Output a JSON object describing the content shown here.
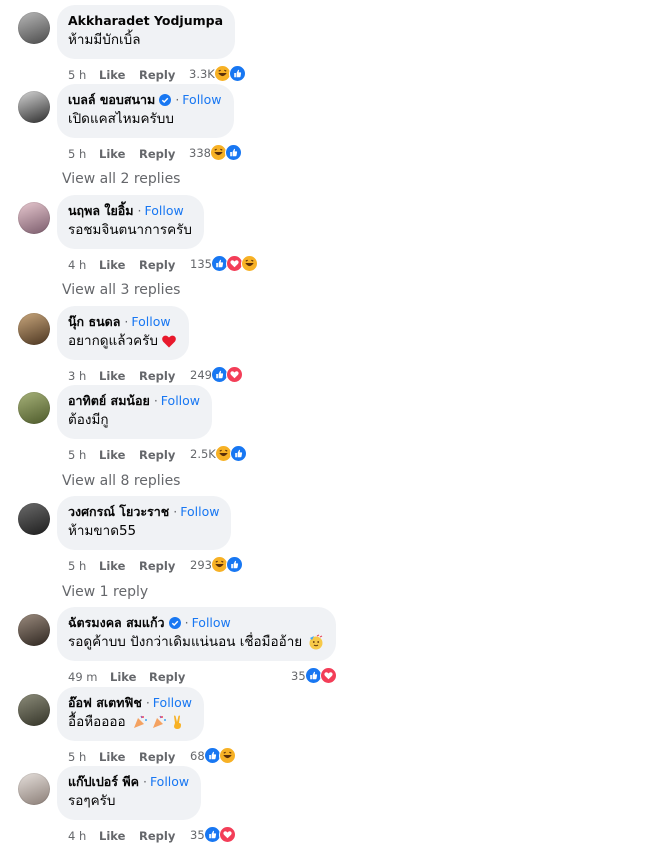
{
  "follow_label": "Follow",
  "like_label": "Like",
  "reply_label": "Reply",
  "comments": [
    {
      "name": "Akkharadet Yodjumpa",
      "text": "ห้ามมีบักเบิ้ล",
      "time": "5 h",
      "count": "3.3K",
      "reactions": [
        "haha",
        "like"
      ],
      "follow": false,
      "verified": false
    },
    {
      "name": "เบลล์ ขอบสนาม",
      "text": "เปิดแคสไหมครับบ",
      "time": "5 h",
      "count": "338",
      "reactions": [
        "haha",
        "like"
      ],
      "follow": true,
      "verified": true
    },
    {
      "name": "นฤพล ใยอิ้ม",
      "text": "รอชมจินตนาการครับ",
      "time": "4 h",
      "count": "135",
      "reactions": [
        "like",
        "love",
        "haha"
      ],
      "follow": true,
      "verified": false
    },
    {
      "name": "นุ๊ก ธนดล",
      "text": "อยากดูแล้วครับ",
      "time": "3 h",
      "count": "249",
      "reactions": [
        "like",
        "love"
      ],
      "follow": true,
      "verified": false,
      "trailing": "heart"
    },
    {
      "name": "อาทิตย์ สมน้อย",
      "text": "ต้องมีกู",
      "time": "5 h",
      "count": "2.5K",
      "reactions": [
        "haha",
        "like"
      ],
      "follow": true,
      "verified": false
    },
    {
      "name": "วงศกรณ์ โยวะราช",
      "text": "ห้ามขาด55",
      "time": "5 h",
      "count": "293",
      "reactions": [
        "haha",
        "like"
      ],
      "follow": true,
      "verified": false
    },
    {
      "name": "ฉัตรมงคล สมแก้ว",
      "text": "รอดูค้าบบ ปังกว่าเดิมแน่นอน เชื่อมืออ้าย",
      "time": "49 m",
      "count": "35",
      "reactions": [
        "like",
        "love"
      ],
      "follow": true,
      "verified": true,
      "trailing": "party-face"
    },
    {
      "name": "อ๊อฟ สเตทฟิช",
      "text": "อื้อหืออออ",
      "time": "5 h",
      "count": "68",
      "reactions": [
        "like",
        "haha"
      ],
      "follow": true,
      "verified": false,
      "trailing": "party-popper-victory"
    },
    {
      "name": "แก๊ปเปอร์ พีค",
      "text": "รอๆครับ",
      "time": "4 h",
      "count": "35",
      "reactions": [
        "like",
        "love"
      ],
      "follow": true,
      "verified": false
    }
  ],
  "view_replies": [
    "View all 2 replies",
    "View all 3 replies",
    "View all 8 replies",
    "View 1 reply"
  ],
  "colors": {
    "link": "#1877f2",
    "meta": "#65676b",
    "bubble": "#f0f2f5",
    "like": "#1877f2",
    "love": "#f33e58",
    "haha": "#f7b125"
  }
}
